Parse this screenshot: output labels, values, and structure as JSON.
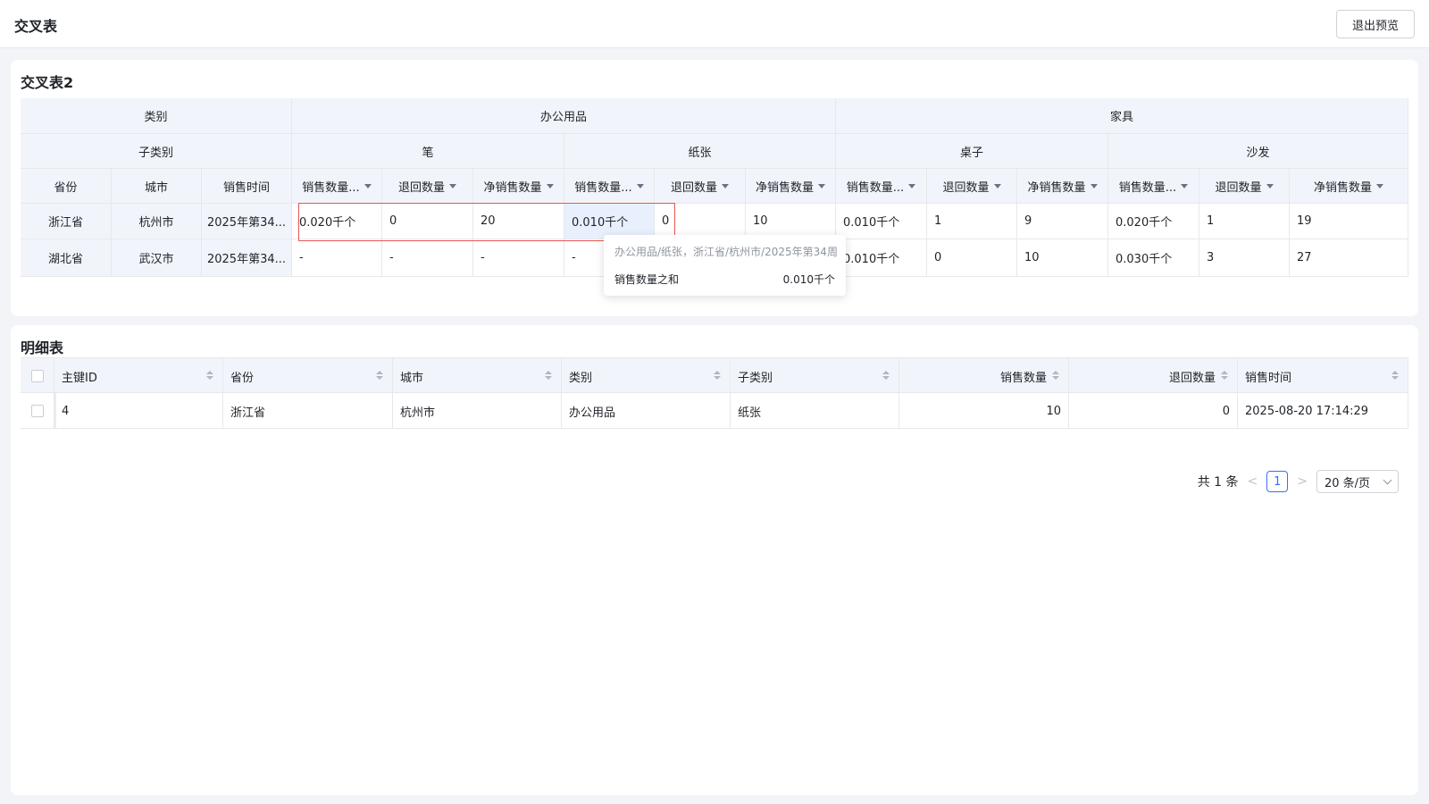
{
  "header": {
    "title": "交叉表",
    "exit_label": "退出预览"
  },
  "cross_table": {
    "title": "交叉表2",
    "level1_label": "类别",
    "level2_label": "子类别",
    "row_dims": [
      "省份",
      "城市",
      "销售时间"
    ],
    "categories": [
      "办公用品",
      "家具"
    ],
    "subcategories": [
      "笔",
      "纸张",
      "桌子",
      "沙发"
    ],
    "measures": [
      "销售数量...",
      "退回数量",
      "净销售数量"
    ],
    "rows": [
      {
        "province": "浙江省",
        "city": "杭州市",
        "time": "2025年第34...",
        "values": [
          "0.020千个",
          "0",
          "20",
          "0.010千个",
          "0",
          "10",
          "0.010千个",
          "1",
          "9",
          "0.020千个",
          "1",
          "19"
        ]
      },
      {
        "province": "湖北省",
        "city": "武汉市",
        "time": "2025年第34...",
        "values": [
          "-",
          "-",
          "-",
          "-",
          "",
          "",
          "0.010千个",
          "0",
          "10",
          "0.030千个",
          "3",
          "27"
        ]
      }
    ],
    "tooltip": {
      "title": "办公用品/纸张，浙江省/杭州市/2025年第34周",
      "label": "销售数量之和",
      "value": "0.010千个"
    }
  },
  "detail_table": {
    "title": "明细表",
    "columns": [
      "主键ID",
      "省份",
      "城市",
      "类别",
      "子类别",
      "销售数量",
      "退回数量",
      "销售时间"
    ],
    "rows": [
      [
        "4",
        "浙江省",
        "杭州市",
        "办公用品",
        "纸张",
        "10",
        "0",
        "2025-08-20 17:14:29"
      ]
    ]
  },
  "pagination": {
    "total": "共 1 条",
    "prev": "<",
    "page": "1",
    "next": ">",
    "size": "20 条/页"
  }
}
